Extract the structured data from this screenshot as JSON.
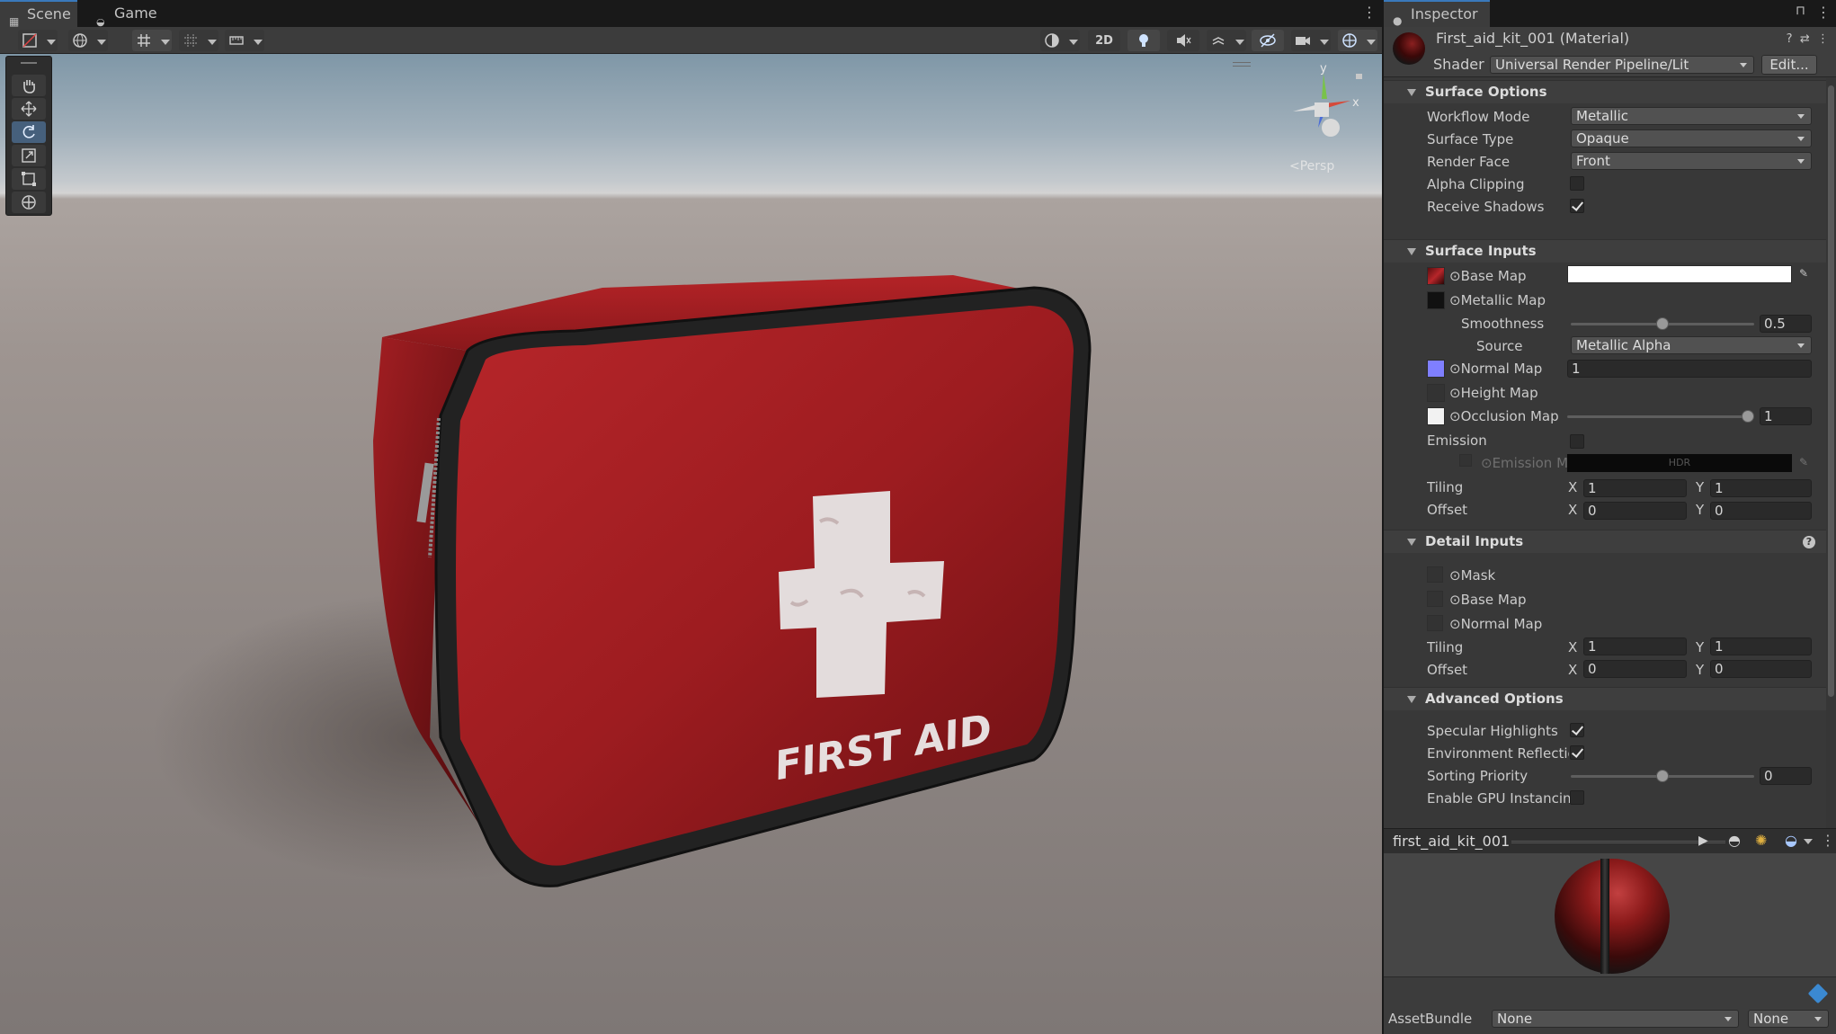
{
  "scene_panel": {
    "tabs": [
      {
        "label": "Scene",
        "icon": "grid-icon"
      },
      {
        "label": "Game",
        "icon": "gamepad-icon"
      }
    ],
    "toolbar": {
      "mode_2d": "2D"
    },
    "gizmo": {
      "projection_label": "Persp",
      "axes": [
        "y",
        "x"
      ]
    },
    "tools": [
      "hand-tool",
      "move-tool",
      "rotate-tool",
      "scale-tool",
      "rect-tool",
      "transform-tool"
    ],
    "scene_object": {
      "label": "FIRST AID"
    }
  },
  "inspector": {
    "tab": "Inspector",
    "title": "First_aid_kit_001 (Material)",
    "shader_label": "Shader",
    "shader_value": "Universal Render Pipeline/Lit",
    "edit_button": "Edit...",
    "surface_options": {
      "title": "Surface Options",
      "workflow_mode": {
        "label": "Workflow Mode",
        "value": "Metallic"
      },
      "surface_type": {
        "label": "Surface Type",
        "value": "Opaque"
      },
      "render_face": {
        "label": "Render Face",
        "value": "Front"
      },
      "alpha_clipping": {
        "label": "Alpha Clipping",
        "checked": false
      },
      "receive_shadows": {
        "label": "Receive Shadows",
        "checked": true
      }
    },
    "surface_inputs": {
      "title": "Surface Inputs",
      "base_map": "Base Map",
      "metallic_map": "Metallic Map",
      "smoothness": {
        "label": "Smoothness",
        "value": "0.5",
        "fraction": 0.5
      },
      "source": {
        "label": "Source",
        "value": "Metallic Alpha"
      },
      "normal_map": {
        "label": "Normal Map",
        "value": "1"
      },
      "height_map": "Height Map",
      "occlusion_map": {
        "label": "Occlusion Map",
        "value": "1",
        "fraction": 1.0
      },
      "emission": {
        "label": "Emission",
        "checked": false
      },
      "emission_map": "Emission M",
      "emission_hdr": "HDR",
      "tiling": {
        "label": "Tiling",
        "x": "1",
        "y": "1"
      },
      "offset": {
        "label": "Offset",
        "x": "0",
        "y": "0"
      }
    },
    "detail_inputs": {
      "title": "Detail Inputs",
      "mask": "Mask",
      "base_map": "Base Map",
      "normal_map": "Normal Map",
      "tiling": {
        "label": "Tiling",
        "x": "1",
        "y": "1"
      },
      "offset": {
        "label": "Offset",
        "x": "0",
        "y": "0"
      }
    },
    "advanced_options": {
      "title": "Advanced Options",
      "specular_highlights": {
        "label": "Specular Highlights",
        "checked": true
      },
      "environment_reflections": {
        "label": "Environment Reflectio",
        "checked": true
      },
      "sorting_priority": {
        "label": "Sorting Priority",
        "value": "0"
      },
      "gpu_instancing": {
        "label": "Enable GPU Instancinç",
        "checked": false
      }
    },
    "axis_x": "X",
    "axis_y": "Y",
    "preview": {
      "name": "first_aid_kit_001"
    },
    "asset_bundle": {
      "label": "AssetBundle",
      "value": "None",
      "variant": "None"
    }
  },
  "colors": {
    "accent": "#3a79bb",
    "kit_red": "#a31e22",
    "normal_map_thumb": "#7f7fff"
  }
}
